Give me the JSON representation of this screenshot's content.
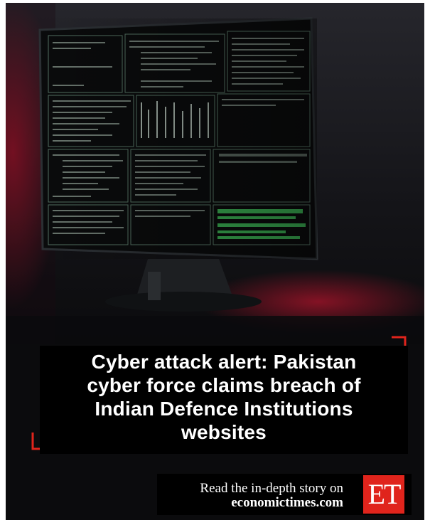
{
  "headline": {
    "lines": [
      "Cyber attack alert: Pakistan",
      "cyber force claims breach of",
      "Indian Defence Institutions",
      "websites"
    ]
  },
  "footer": {
    "read_text": "Read the in-depth story on",
    "site": "economictimes.com",
    "logo_text": "ET"
  },
  "colors": {
    "background": "#0b0b0d",
    "accent": "#e0241c",
    "text": "#ffffff"
  }
}
